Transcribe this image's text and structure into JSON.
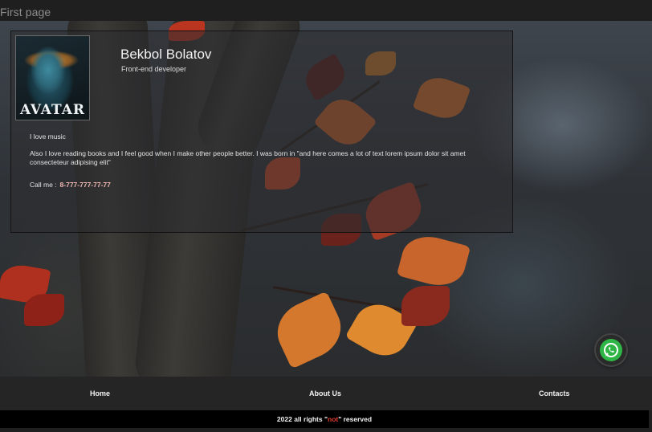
{
  "page_title": "First page",
  "profile": {
    "avatar_logo": "AVATAR",
    "name": "Bekbol Bolatov",
    "role": "Front-end developer",
    "about_short": "I love music",
    "about_long": "Also I love reading books and I feel good when I make other people better. I was born in \"and here comes a lot of text lorem ipsum dolor sit amet consecteteur adipising elit\"",
    "call_label": "Call me :",
    "phone": "8-777-777-77-77",
    "phone_color": "#f2b9b3"
  },
  "nav": {
    "home": "Home",
    "about": "About Us",
    "contacts": "Contacts"
  },
  "footer": {
    "prefix": "2022 all rights \"",
    "highlight": "not",
    "suffix": "\" reserved",
    "highlight_color": "#e03a2c"
  },
  "whatsapp": {
    "icon": "whatsapp-icon",
    "color": "#2fb446"
  }
}
